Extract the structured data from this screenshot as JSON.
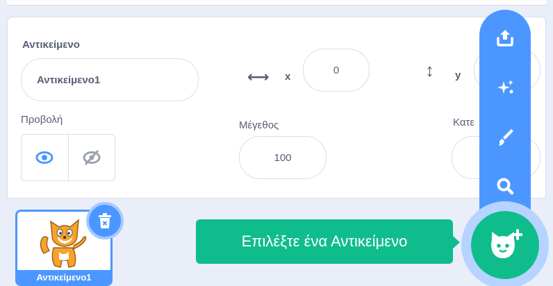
{
  "sprite_info": {
    "sprite_label": "Αντικείμενο",
    "sprite_name": "Αντικείμενο1",
    "x_label": "x",
    "x_value": "0",
    "y_label": "y",
    "y_value": "",
    "show_label": "Προβολή",
    "size_label": "Μέγεθος",
    "size_value": "100",
    "direction_label": "Κατε",
    "direction_value": ""
  },
  "sprite_list": {
    "tile_name": "Αντικείμενο1"
  },
  "add_sprite_menu": {
    "tooltip": "Επιλέξτε ένα Αντικείμενο",
    "items": [
      "upload-icon",
      "surprise-icon",
      "paint-icon",
      "search-icon"
    ]
  },
  "colors": {
    "accent": "#4c97ff",
    "green": "#0fbd8c",
    "text": "#575e75"
  }
}
